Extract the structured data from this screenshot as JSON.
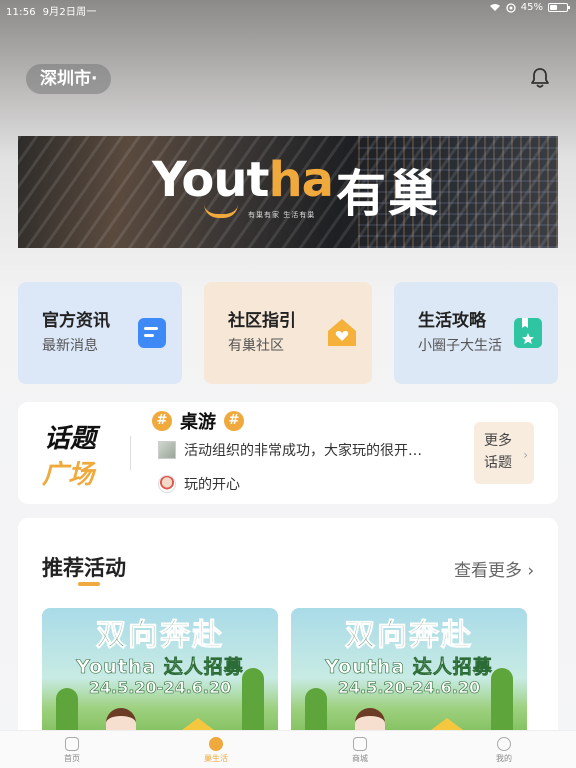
{
  "status_bar": {
    "time": "11:56",
    "date": "9月2日周一",
    "battery": "45%"
  },
  "header": {
    "city": "深圳市·"
  },
  "banner": {
    "logo_en_main": "Yout",
    "logo_en_accent": "ha",
    "logo_cn": "有巢",
    "tagline": "有巢有家 生活有巢"
  },
  "quick_links": [
    {
      "title": "官方资讯",
      "subtitle": "最新消息"
    },
    {
      "title": "社区指引",
      "subtitle": "有巢社区"
    },
    {
      "title": "生活攻略",
      "subtitle": "小圈子大生活"
    }
  ],
  "topics": {
    "title_line1": "话题",
    "title_line2": "广场",
    "hash_symbol": "#",
    "topic_name": "桌游",
    "posts": [
      {
        "text": "活动组织的非常成功，大家玩的很开…"
      },
      {
        "text": "玩的开心"
      }
    ],
    "more_line1": "更多",
    "more_line2": "话题"
  },
  "recommended": {
    "title": "推荐活动",
    "more": "查看更多",
    "posters": [
      {
        "headline": "双向奔赴",
        "subline": "Youtha 达人招募",
        "date": "24.5.20-24.6.20"
      },
      {
        "headline": "双向奔赴",
        "subline": "Youtha 达人招募",
        "date": "24.5.20-24.6.20"
      }
    ]
  },
  "tab_bar": [
    {
      "label": "首页",
      "active": false
    },
    {
      "label": "巢生活",
      "active": true
    },
    {
      "label": "商城",
      "active": false
    },
    {
      "label": "我的",
      "active": false
    }
  ],
  "colors": {
    "accent": "#f0a93c",
    "card_blue": "#dce8f8",
    "card_peach": "#f6e7d7"
  }
}
